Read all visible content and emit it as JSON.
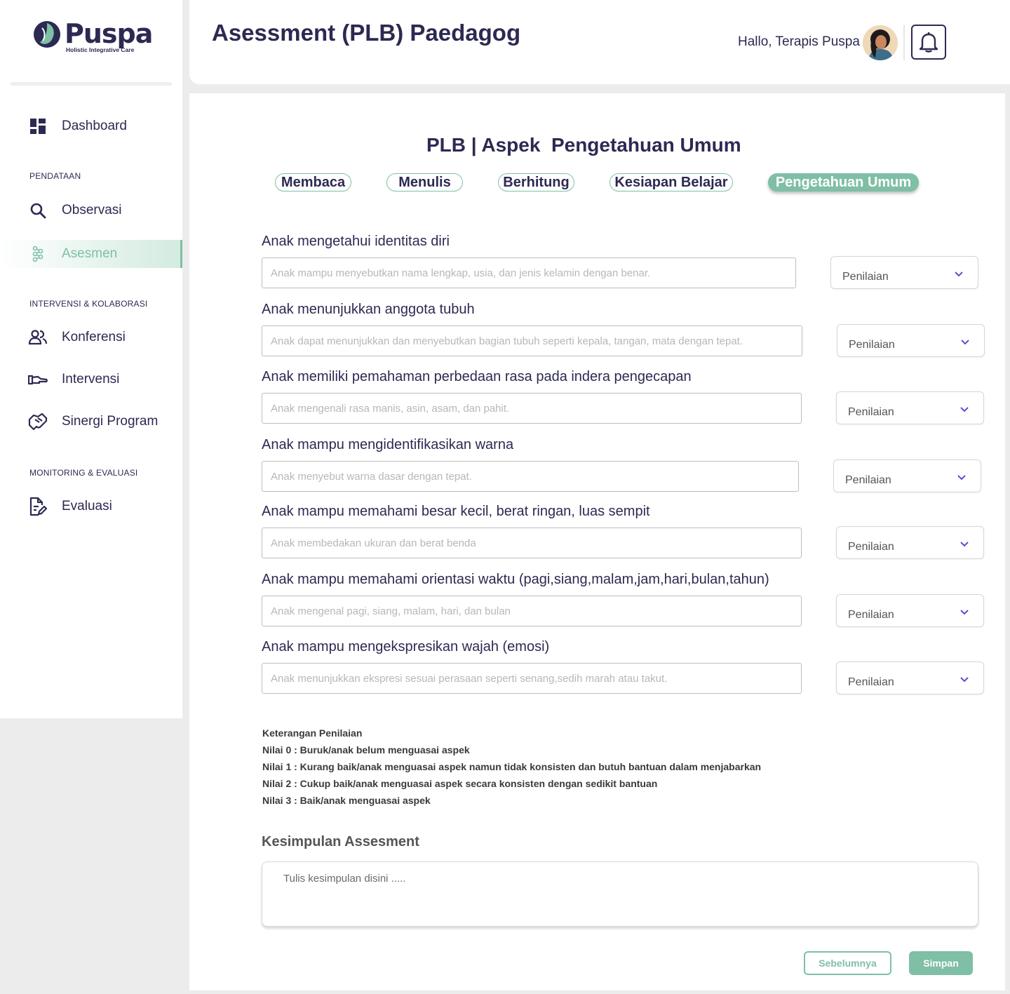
{
  "brand": {
    "name": "Puspa",
    "tagline": "Holistic Integrative Care"
  },
  "sidebar": {
    "dashboard": {
      "label": "Dashboard",
      "icon": "dashboard-icon"
    },
    "sections": [
      {
        "title": "PENDATAAN"
      },
      {
        "title": "INTERVENSI & KOLABORASI"
      },
      {
        "title": "MONITORING & EVALUASI"
      }
    ],
    "items": [
      {
        "label": "Observasi",
        "icon": "search-icon"
      },
      {
        "label": "Asesmen",
        "icon": "assessment-icon",
        "active": true
      },
      {
        "label": "Konferensi",
        "icon": "users-icon"
      },
      {
        "label": "Intervensi",
        "icon": "hand-icon"
      },
      {
        "label": "Sinergi Program",
        "icon": "handshake-icon"
      },
      {
        "label": "Evaluasi",
        "icon": "edit-document-icon"
      }
    ]
  },
  "header": {
    "title": "Asessment (PLB) Paedagog",
    "greeting": "Hallo, Terapis Puspa",
    "notification_icon": "bell-icon"
  },
  "main": {
    "section_title": "PLB | Aspek  Pengetahuan Umum",
    "tabs": [
      {
        "label": "Membaca"
      },
      {
        "label": "Menulis"
      },
      {
        "label": "Berhitung"
      },
      {
        "label": "Kesiapan Belajar"
      },
      {
        "label": "Pengetahuan Umum",
        "active": true
      }
    ],
    "questions": [
      {
        "label": "Anak mengetahui identitas diri",
        "placeholder": "Anak mampu menyebutkan nama lengkap, usia, dan jenis kelamin dengan benar.",
        "select": "Penilaian"
      },
      {
        "label": "Anak menunjukkan anggota tubuh",
        "placeholder": "Anak dapat menunjukkan dan menyebutkan bagian tubuh seperti kepala, tangan, mata dengan tepat.",
        "select": "Penilaian"
      },
      {
        "label": "Anak memiliki pemahaman perbedaan rasa pada indera pengecapan",
        "placeholder": "Anak mengenali rasa manis, asin, asam, dan pahit.",
        "select": "Penilaian"
      },
      {
        "label": "Anak mampu mengidentifikasikan warna",
        "placeholder": "Anak menyebut warna dasar dengan tepat.",
        "select": "Penilaian"
      },
      {
        "label": "Anak mampu memahami besar kecil, berat ringan, luas sempit",
        "placeholder": "Anak membedakan ukuran dan berat benda",
        "select": "Penilaian"
      },
      {
        "label": "Anak mampu memahami orientasi waktu (pagi,siang,malam,jam,hari,bulan,tahun)",
        "placeholder": "Anak mengenal pagi, siang, malam, hari, dan bulan",
        "select": "Penilaian"
      },
      {
        "label": "Anak mampu mengekspresikan wajah (emosi)",
        "placeholder": "Anak menunjukkan ekspresi sesuai perasaan seperti senang,sedih marah atau takut.",
        "select": "Penilaian"
      }
    ],
    "legend": {
      "title": "Keterangan Penilaian",
      "lines": [
        "Nilai 0 : Buruk/anak belum menguasai aspek",
        "Nilai 1 : Kurang baik/anak menguasai aspek namun tidak konsisten dan butuh bantuan dalam menjabarkan",
        "Nilai 2 : Cukup baik/anak menguasai aspek secara konsisten dengan sedikit bantuan",
        "Nilai 3 : Baik/anak menguasai aspek"
      ]
    },
    "conclusion": {
      "title": "Kesimpulan Assesment",
      "placeholder": "Tulis kesimpulan disini ....."
    },
    "buttons": {
      "prev": "Sebelumnya",
      "save": "Simpan"
    }
  },
  "colors": {
    "primary": "#2c2a52",
    "accent": "#7fbfa5",
    "background": "#ececec"
  }
}
